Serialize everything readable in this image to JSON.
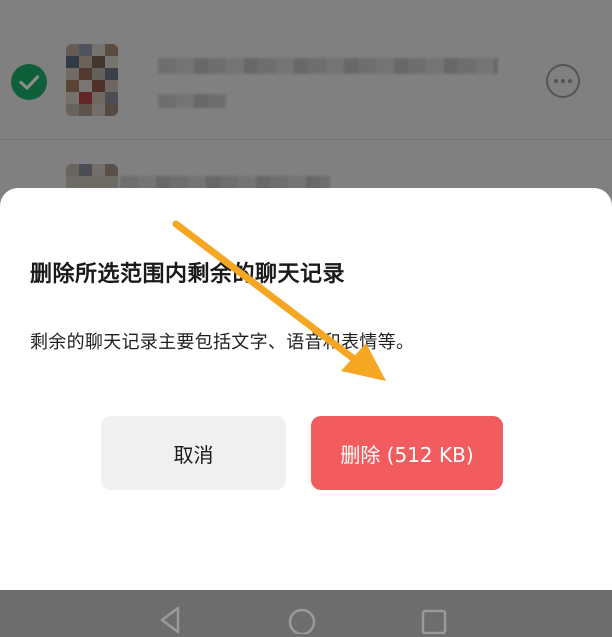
{
  "dialog": {
    "title": "删除所选范围内剩余的聊天记录",
    "description": "剩余的聊天记录主要包括文字、语音和表情等。",
    "cancel_label": "取消",
    "delete_label": "删除 (512 KB)"
  },
  "colors": {
    "delete_button": "#f25c5f",
    "cancel_button": "#f0f0f0",
    "check_green": "#1aad6b",
    "annotation_arrow": "#f5a623"
  },
  "icons": {
    "check": "check-icon",
    "more": "more-options-icon",
    "back": "nav-back-icon",
    "home": "nav-home-icon",
    "recents": "nav-recents-icon"
  }
}
